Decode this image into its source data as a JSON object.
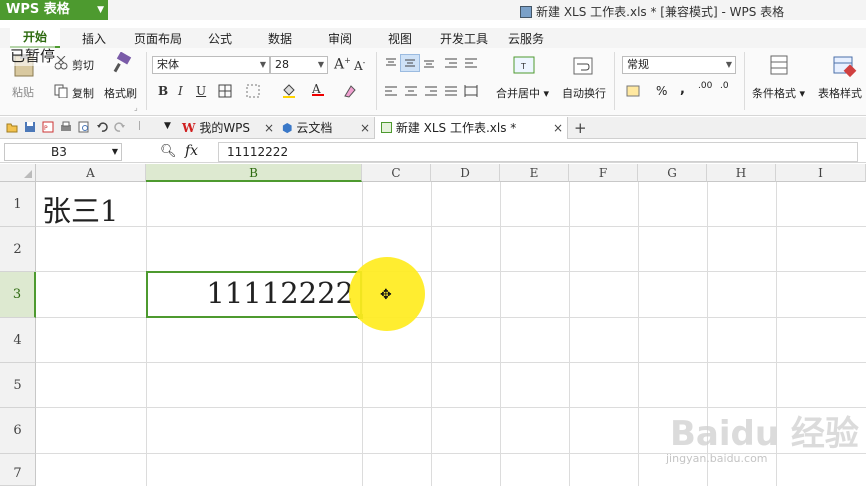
{
  "app": {
    "logo_text": "WPS 表格",
    "window_title": "新建 XLS 工作表.xls * [兼容模式] - WPS 表格"
  },
  "menu": {
    "tabs": [
      "开始",
      "插入",
      "页面布局",
      "公式",
      "数据",
      "审阅",
      "视图",
      "开发工具",
      "云服务"
    ]
  },
  "ribbon": {
    "overlay_text": "已暂停",
    "cut": "剪切",
    "paste": "粘贴",
    "copy": "复制",
    "format_painter": "格式刷",
    "font_name": "宋体",
    "font_size": "28",
    "merge_center": "合并居中",
    "wrap_text": "自动换行",
    "number_format": "常规",
    "conditional_format": "条件格式",
    "table_style": "表格样式",
    "percent": "%",
    "comma": ",",
    "inc_decimal": ".00",
    "dec_decimal": ".0"
  },
  "doc_tabs": {
    "my_wps": "我的WPS",
    "cloud_docs": "云文档",
    "active": "新建 XLS 工作表.xls *",
    "add": "+"
  },
  "formula_bar": {
    "cell_ref": "B3",
    "fx": "fx",
    "value": "11112222"
  },
  "sheet": {
    "columns": [
      "A",
      "B",
      "C",
      "D",
      "E",
      "F",
      "G",
      "H",
      "I"
    ],
    "rows": [
      "1",
      "2",
      "3",
      "4",
      "5",
      "6",
      "7"
    ],
    "cells": {
      "A1": "张三1",
      "B3": "11112222"
    },
    "selected_cell": "B3"
  },
  "watermark": {
    "text": "Baidu 经验",
    "url": "jingyan.baidu.com"
  },
  "colors": {
    "accent": "#4d9a2f",
    "highlight": "#ffec1e"
  }
}
